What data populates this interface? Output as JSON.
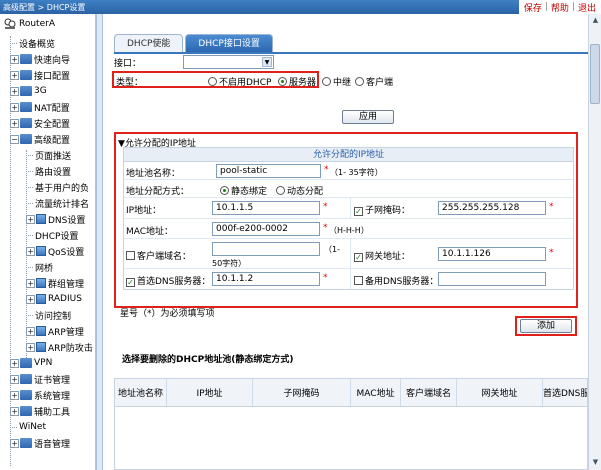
{
  "header": {
    "breadcrumb": "高级配置 > DHCP设置",
    "links": {
      "save": "保存",
      "help": "帮助",
      "logout": "退出"
    }
  },
  "sidebar": {
    "root": "RouterA",
    "items": [
      {
        "label": "设备概览"
      },
      {
        "label": "快速向导"
      },
      {
        "label": "接口配置"
      },
      {
        "label": "3G"
      },
      {
        "label": "NAT配置"
      },
      {
        "label": "安全配置"
      },
      {
        "label": "高级配置"
      },
      {
        "label": "页面推送"
      },
      {
        "label": "路由设置"
      },
      {
        "label": "基于用户的负"
      },
      {
        "label": "流量统计排名"
      },
      {
        "label": "DNS设置"
      },
      {
        "label": "DHCP设置"
      },
      {
        "label": "QoS设置"
      },
      {
        "label": "网桥"
      },
      {
        "label": "群组管理"
      },
      {
        "label": "RADIUS"
      },
      {
        "label": "访问控制"
      },
      {
        "label": "ARP管理"
      },
      {
        "label": "ARP防攻击"
      },
      {
        "label": "VPN"
      },
      {
        "label": "证书管理"
      },
      {
        "label": "系统管理"
      },
      {
        "label": "辅助工具"
      },
      {
        "label": "WiNet"
      },
      {
        "label": "语音管理"
      }
    ]
  },
  "tabs": [
    {
      "label": "DHCP使能"
    },
    {
      "label": "DHCP接口设置"
    }
  ],
  "form": {
    "interface_label": "接口：",
    "interface_value": "",
    "type_label": "类型：",
    "type_options": [
      "不启用DHCP",
      "服务器",
      "中继",
      "客户端"
    ],
    "apply_label": "应用"
  },
  "pool": {
    "section_title": "▼允许分配的IP地址",
    "grid_title": "允许分配的IP地址",
    "name_label": "地址池名称：",
    "name_value": "pool-static",
    "name_hint": "（1- 35字符）",
    "method_label": "地址分配方式：",
    "method_options": [
      "静态绑定",
      "动态分配"
    ],
    "ip_label": "IP地址：",
    "ip_value": "10.1.1.5",
    "mask_label": "子网掩码：",
    "mask_value": "255.255.255.128",
    "mac_label": "MAC地址：",
    "mac_value": "000f-e200-0002",
    "mac_hint": "（H-H-H）",
    "client_label": "客户端域名：",
    "client_value": "",
    "client_hint_a": "（1-",
    "client_hint_b": "50字符）",
    "gateway_label": "网关地址：",
    "gateway_value": "10.1.1.126",
    "dns1_label": "首选DNS服务器：",
    "dns1_value": "10.1.1.2",
    "dns2_label": "备用DNS服务器：",
    "dns2_value": "",
    "star": "*"
  },
  "note": "星号（*）为必须填写项",
  "add_label": "添加",
  "delete_title": "选择要删除的DHCP地址池(静态绑定方式)",
  "table_headers": [
    "地址池名称",
    "IP地址",
    "子网掩码",
    "MAC地址",
    "客户端域名",
    "网关地址",
    "首选DNS服"
  ]
}
